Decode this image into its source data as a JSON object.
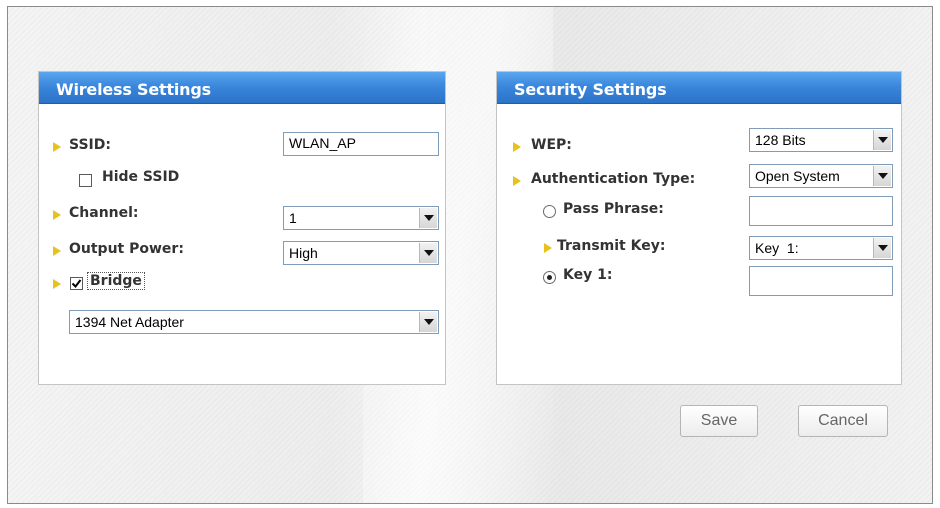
{
  "wireless": {
    "title": "Wireless Settings",
    "ssid_label": "SSID:",
    "ssid_value": "WLAN_AP",
    "hide_ssid_label": "Hide SSID",
    "hide_ssid_checked": false,
    "channel_label": "Channel:",
    "channel_value": "1",
    "output_power_label": "Output Power:",
    "output_power_value": "High",
    "bridge_label": "Bridge",
    "bridge_checked": true,
    "adapter_value": "1394 Net Adapter"
  },
  "security": {
    "title": "Security Settings",
    "wep_label": "WEP:",
    "wep_value": "128 Bits",
    "auth_label": "Authentication Type:",
    "auth_value": "Open System",
    "pass_phrase_label": "Pass Phrase:",
    "pass_phrase_value": "",
    "transmit_key_label": "Transmit Key:",
    "transmit_key_value": "Key  1:",
    "key1_label": "Key 1:",
    "key1_value": "",
    "key_mode": "key1"
  },
  "buttons": {
    "save": "Save",
    "cancel": "Cancel"
  },
  "colors": {
    "header_blue": "#3a87dc",
    "arrow_yellow": "#e8c21a"
  }
}
